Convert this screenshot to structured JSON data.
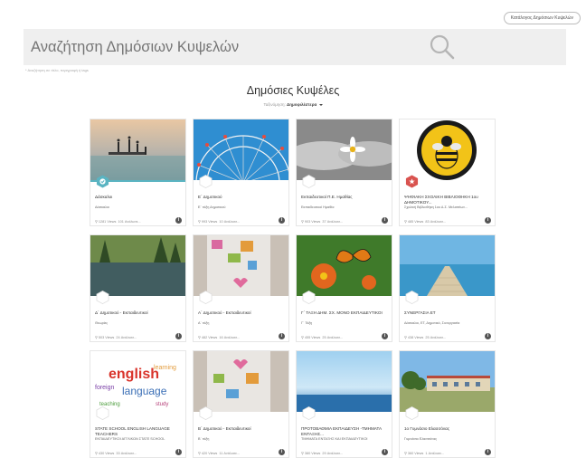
{
  "header": {
    "catalog_button": "Κατάλογος Δημόσιων Κυψελών"
  },
  "search": {
    "placeholder": "Αναζήτηση Δημόσιων Κυψελών",
    "hint": "* Αναζήτηση σε τίτλο, περιγραφή ή tags"
  },
  "section": {
    "title": "Δημόσιες Κυψέλες",
    "sort_label": "Ταξινόμηση:",
    "sort_value": "Δημοφιλέστερα"
  },
  "colors": {
    "accent": "#5ab4c2",
    "badge_red": "#d9534f",
    "search_bg": "#efefef"
  },
  "cards": [
    {
      "title": "Δάσκαλοι",
      "subtitle": "Δάσκαλοι",
      "views": "1281 Views",
      "activities": "101 Ανάλυσε...",
      "badge": "check-badge"
    },
    {
      "title": "Ε΄ Δημοτικού",
      "subtitle": "Ε΄ τάξη Δημοτικού",
      "views": "993 Views",
      "activities": "10 Ανάλυσε...",
      "badge": "none"
    },
    {
      "title": "Εκπαιδευτικοί Π.Ε. Ημαθίας",
      "subtitle": "Εκπαιδευτικοί Ημαθία",
      "views": "903 Views",
      "activities": "37 Ανάλυσε...",
      "badge": "none"
    },
    {
      "title": "ΨΗΦΙΑΚΗ ΣΧΟΛΙΚΗ ΒΙΒΛΙΟΘΗΚΗ 1ου ΔΗΜΟΤΙΚΟΥ...",
      "subtitle": "Σχολική Βιβλιοθήκη 1ου Δ.Σ. Μελισσίων...",
      "views": "485 Views",
      "activities": "83 Ανάλυσε...",
      "badge": "star-badge"
    },
    {
      "title": "Δ΄ Δημοτικού - Εκπαιδευτικοί",
      "subtitle": "Θεωρίες",
      "views": "503 Views",
      "activities": "24 Ανάλυσε...",
      "badge": "none"
    },
    {
      "title": "Α΄ Δημοτικού - Εκπαιδευτικοί",
      "subtitle": "Α΄ τάξη",
      "views": "482 Views",
      "activities": "16 Ανάλυσε...",
      "badge": "none"
    },
    {
      "title": "Γ΄ ΤΑΞΗ ΔΗΜ. ΣΧ. ΜΟΝΟ ΕΚΠΑΙΔΕΥΤΙΚΟΙ",
      "subtitle": "Γ΄ Τάξη",
      "views": "455 Views",
      "activities": "25 Ανάλυσε...",
      "badge": "none"
    },
    {
      "title": "ΣΥΝΕΡΓΑΣΙΑ ΕΤ",
      "subtitle": "Δάσκαλοι, ΕΤ, Δημοτικό, Συνεργασία",
      "views": "438 Views",
      "activities": "25 Ανάλυσε...",
      "badge": "none"
    },
    {
      "title": "STATE SCHOOL ENGLISH LANGUAGE TEACHERS",
      "subtitle": "ΕΚΠΑΙΔΕΥΤΙΚΟΙ ΑΓΓΛΙΚΩΝ ΣΤΑΤΕ SCHOOL",
      "views": "430 Views",
      "activities": "33 Ανάλυσε...",
      "badge": "none"
    },
    {
      "title": "Β΄ Δημοτικού - Εκπαιδευτικοί",
      "subtitle": "Β΄ τάξη",
      "views": "420 Views",
      "activities": "11 Ανάλυσε...",
      "badge": "none"
    },
    {
      "title": "ΠΡΟΤΟΒΑΘΜΙΑ ΕΚΠΑΙΔΕΥΣΗ -ΤΜΗΜΑΤΑ ΕΝΤΑΞΗΣ...",
      "subtitle": "ΤΜΗΜΑΤΑ ΕΝΤΑΞΗΣ ΚΑΙ ΕΚΠΑΙΔΕΥΤΙΚΟΙ",
      "views": "380 Views",
      "activities": "29 Ανάλυσε...",
      "badge": "none"
    },
    {
      "title": "1ο Γυμνάσιο Ελασσόνας",
      "subtitle": "Γυμνάσιο Ελασσόνας",
      "views": "360 Views",
      "activities": "1 Ανάλυσε...",
      "badge": "none"
    }
  ]
}
